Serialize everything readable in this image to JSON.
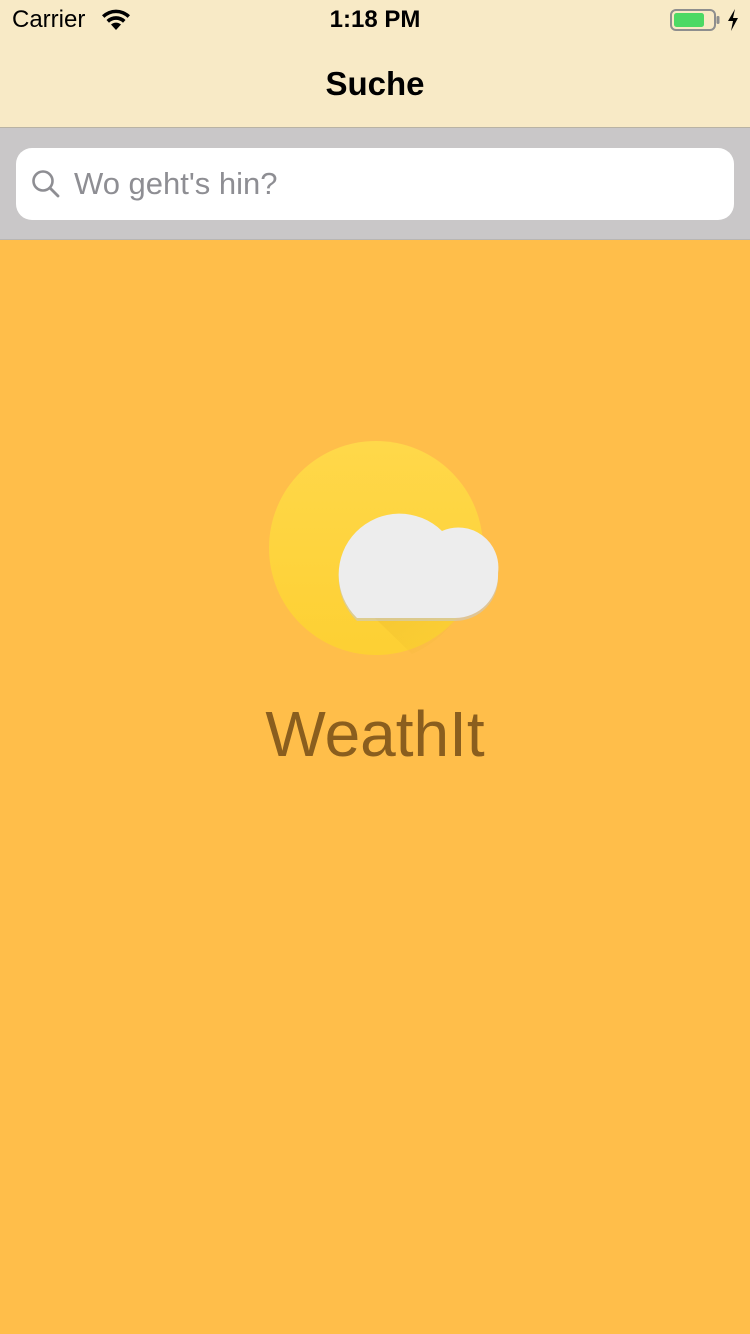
{
  "status_bar": {
    "carrier": "Carrier",
    "time": "1:18 PM",
    "icons": [
      "wifi-icon",
      "battery-icon",
      "charging-bolt-icon"
    ],
    "battery_color": "#4CD964"
  },
  "nav": {
    "title": "Suche",
    "background": "#F8EAC6"
  },
  "search": {
    "placeholder": "Wo geht's hin?",
    "value": "",
    "icon": "search-icon"
  },
  "main": {
    "background": "#FFBE4A",
    "logo_icon": "sun-cloud-icon",
    "app_name": "WeathIt",
    "app_name_color": "#8A5E1E"
  }
}
